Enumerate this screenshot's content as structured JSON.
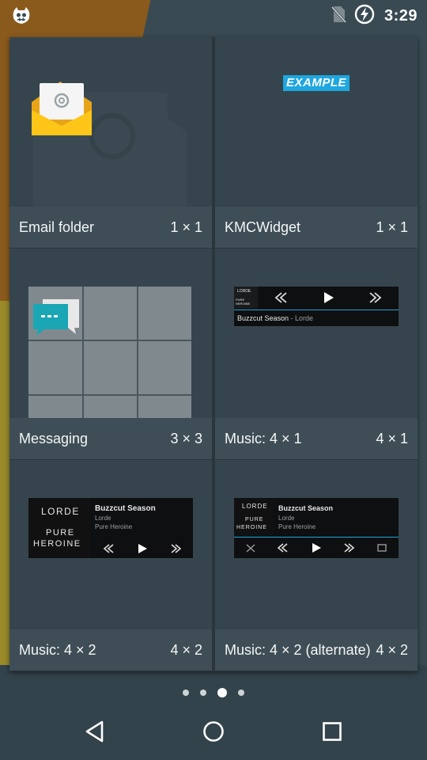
{
  "status_bar": {
    "time": "3:29",
    "left_icon": "cyanogen-mascot-icon",
    "icons": [
      "no-sim-icon",
      "battery-charging-icon"
    ]
  },
  "widgets": [
    {
      "label": "Email folder",
      "size": "1 × 1",
      "preview": "email-envelope-icon"
    },
    {
      "label": "KMCWidget",
      "size": "1 × 1",
      "preview_text": "EXAMPLE"
    },
    {
      "label": "Messaging",
      "size": "3 × 3",
      "preview": "messaging-bubble-icon"
    },
    {
      "label": "Music: 4 × 1",
      "size": "4 × 1",
      "preview": {
        "album_top": "LORDE",
        "album_bottom": "PURE HEROINE",
        "track": "Buzzcut Season",
        "artist": "Lorde"
      }
    },
    {
      "label": "Music: 4 × 2",
      "size": "4 × 2",
      "preview": {
        "album_top": "LORDE",
        "album_line1": "PURE",
        "album_line2": "HEROINE",
        "track": "Buzzcut Season",
        "artist": "Lorde",
        "album": "Pure Heroine"
      }
    },
    {
      "label": "Music: 4 × 2 (alternate)",
      "size": "4 × 2",
      "preview": {
        "album_top": "LORDE",
        "album_line1": "PURE",
        "album_line2": "HEROINE",
        "track": "Buzzcut Season",
        "artist": "Lorde",
        "album": "Pure Heroine"
      }
    }
  ],
  "page_indicator": {
    "pages": 4,
    "current": 3
  },
  "nav": [
    "back-icon",
    "home-icon",
    "recents-icon"
  ],
  "colors": {
    "accent_blue": "#1ea7e0",
    "panel": "#2a363c",
    "tile": "#36454d",
    "footer": "#3f4e56"
  }
}
